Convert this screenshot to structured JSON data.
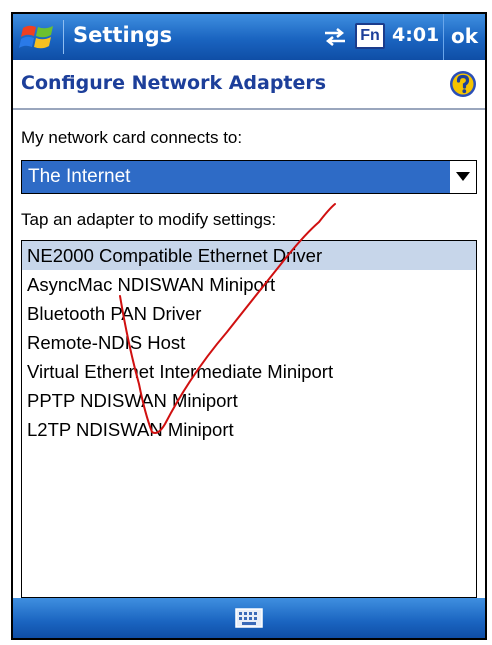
{
  "titlebar": {
    "app_title": "Settings",
    "fn_label": "Fn",
    "time": "4:01",
    "ok_label": "ok",
    "icons": [
      "windows-flag-icon",
      "connectivity-arrows-icon"
    ]
  },
  "header": {
    "title": "Configure Network Adapters",
    "help_icon": "question-mark-icon"
  },
  "network_card": {
    "label": "My network card connects to:",
    "selected": "The Internet"
  },
  "adapters": {
    "label": "Tap an adapter to modify settings:",
    "items": [
      "NE2000 Compatible Ethernet Driver",
      "AsyncMac NDISWAN Miniport",
      "Bluetooth PAN Driver",
      "Remote-NDIS Host",
      "Virtual Ethernet Intermediate Miniport",
      "PPTP NDISWAN Miniport",
      "L2TP NDISWAN Miniport"
    ],
    "selected_index": 0
  },
  "menubar": {
    "icon": "keyboard-icon"
  },
  "colors": {
    "title_blue": "#1a64c0",
    "heading_blue": "#1d3f9a",
    "selection_blue": "#2e6bc6",
    "list_selection": "#c7d6ea",
    "annotation_red": "#d01010"
  }
}
